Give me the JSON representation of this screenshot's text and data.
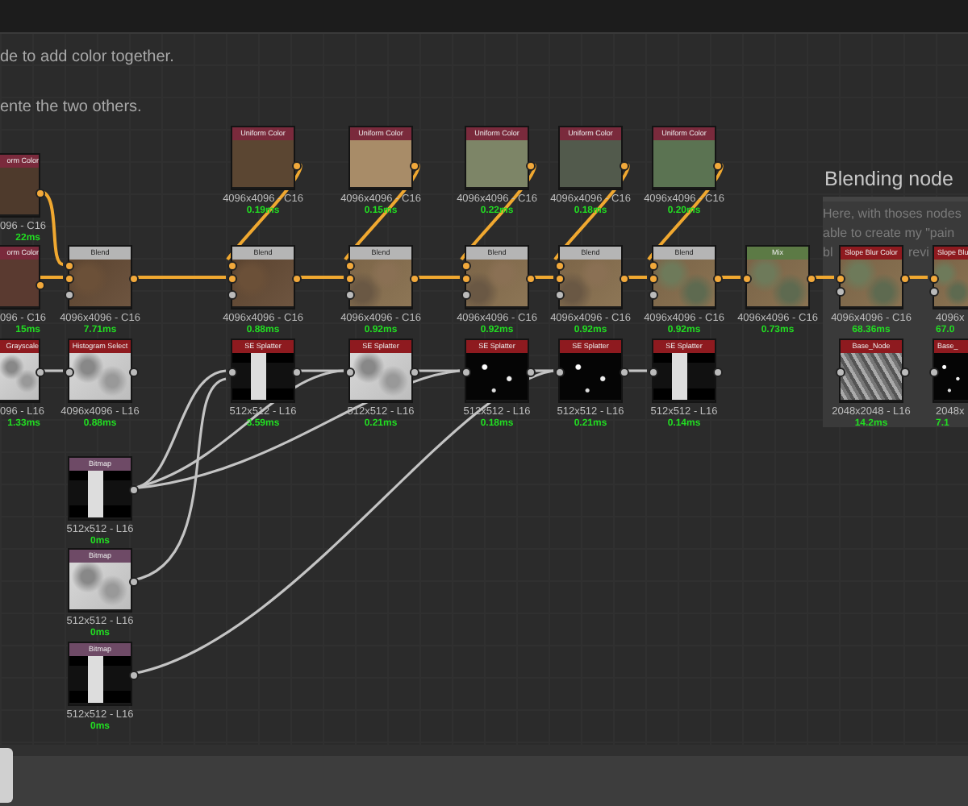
{
  "notes": [
    "de to add color together.",
    "ente the two others."
  ],
  "frame": {
    "title": "Blending node",
    "lines": [
      "Here, with thoses nodes",
      "able to create my \"pain"
    ],
    "fragments": [
      "bl",
      "revi"
    ]
  },
  "nodes": [
    {
      "title": "Uniform Color",
      "kind": "uniform",
      "color": "#5b4632",
      "resolution": "4096x4096 - C16",
      "time": "0.19ms"
    },
    {
      "title": "Uniform Color",
      "kind": "uniform",
      "color": "#a88c68",
      "resolution": "4096x4096 - C16",
      "time": "0.15ms"
    },
    {
      "title": "Uniform Color",
      "kind": "uniform",
      "color": "#7d8567",
      "resolution": "4096x4096 - C16",
      "time": "0.22ms"
    },
    {
      "title": "Uniform Color",
      "kind": "uniform",
      "color": "#525a4c",
      "resolution": "4096x4096 - C16",
      "time": "0.18ms"
    },
    {
      "title": "Uniform Color",
      "kind": "uniform",
      "color": "#5b7352",
      "resolution": "4096x4096 - C16",
      "time": "0.20ms"
    },
    {
      "title": "orm Color",
      "kind": "uniform",
      "color": "#4e3a2c",
      "resolution": "096 - C16",
      "time": "22ms"
    },
    {
      "title": "orm Color",
      "kind": "uniform",
      "color": "#5a3a30",
      "resolution": "096 - C16",
      "time": "15ms"
    },
    {
      "title": "Blend",
      "kind": "blend",
      "resolution": "4096x4096 - C16",
      "time": "7.71ms"
    },
    {
      "title": "Blend",
      "kind": "blend",
      "resolution": "4096x4096 - C16",
      "time": "0.88ms"
    },
    {
      "title": "Blend",
      "kind": "blend",
      "resolution": "4096x4096 - C16",
      "time": "0.92ms"
    },
    {
      "title": "Blend",
      "kind": "blend",
      "resolution": "4096x4096 - C16",
      "time": "0.92ms"
    },
    {
      "title": "Blend",
      "kind": "blend",
      "resolution": "4096x4096 - C16",
      "time": "0.92ms"
    },
    {
      "title": "Blend",
      "kind": "blend",
      "resolution": "4096x4096 - C16",
      "time": "0.92ms"
    },
    {
      "title": "Mix",
      "kind": "mix",
      "resolution": "4096x4096 - C16",
      "time": "0.73ms"
    },
    {
      "title": "Slope Blur Color",
      "kind": "color-filter",
      "resolution": "4096x4096 - C16",
      "time": "68.36ms"
    },
    {
      "title": "Slope Blu",
      "kind": "color-filter",
      "resolution": "4096x",
      "time": "67.0"
    },
    {
      "title": "Grayscale",
      "kind": "gray-filter",
      "resolution": "096 - L16",
      "time": "1.33ms"
    },
    {
      "title": "Histogram Select",
      "kind": "gray-filter",
      "resolution": "4096x4096 - L16",
      "time": "0.88ms"
    },
    {
      "title": "SE Splatter",
      "kind": "gray-filter",
      "resolution": "512x512 - L16",
      "time": "3.59ms"
    },
    {
      "title": "SE Splatter",
      "kind": "gray-filter",
      "resolution": "512x512 - L16",
      "time": "0.21ms"
    },
    {
      "title": "SE Splatter",
      "kind": "gray-filter",
      "resolution": "512x512 - L16",
      "time": "0.18ms"
    },
    {
      "title": "SE Splatter",
      "kind": "gray-filter",
      "resolution": "512x512 - L16",
      "time": "0.21ms"
    },
    {
      "title": "SE Splatter",
      "kind": "gray-filter",
      "resolution": "512x512 - L16",
      "time": "0.14ms"
    },
    {
      "title": "Base_Node",
      "kind": "gray-filter",
      "resolution": "2048x2048 - L16",
      "time": "14.2ms"
    },
    {
      "title": "Base_",
      "kind": "gray-filter",
      "resolution": "2048x",
      "time": "7.1"
    },
    {
      "title": "Bitmap",
      "kind": "bitmap",
      "resolution": "512x512 - L16",
      "time": "0ms"
    },
    {
      "title": "Bitmap",
      "kind": "bitmap",
      "resolution": "512x512 - L16",
      "time": "0ms"
    },
    {
      "title": "Bitmap",
      "kind": "bitmap",
      "resolution": "512x512 - L16",
      "time": "0ms"
    }
  ]
}
